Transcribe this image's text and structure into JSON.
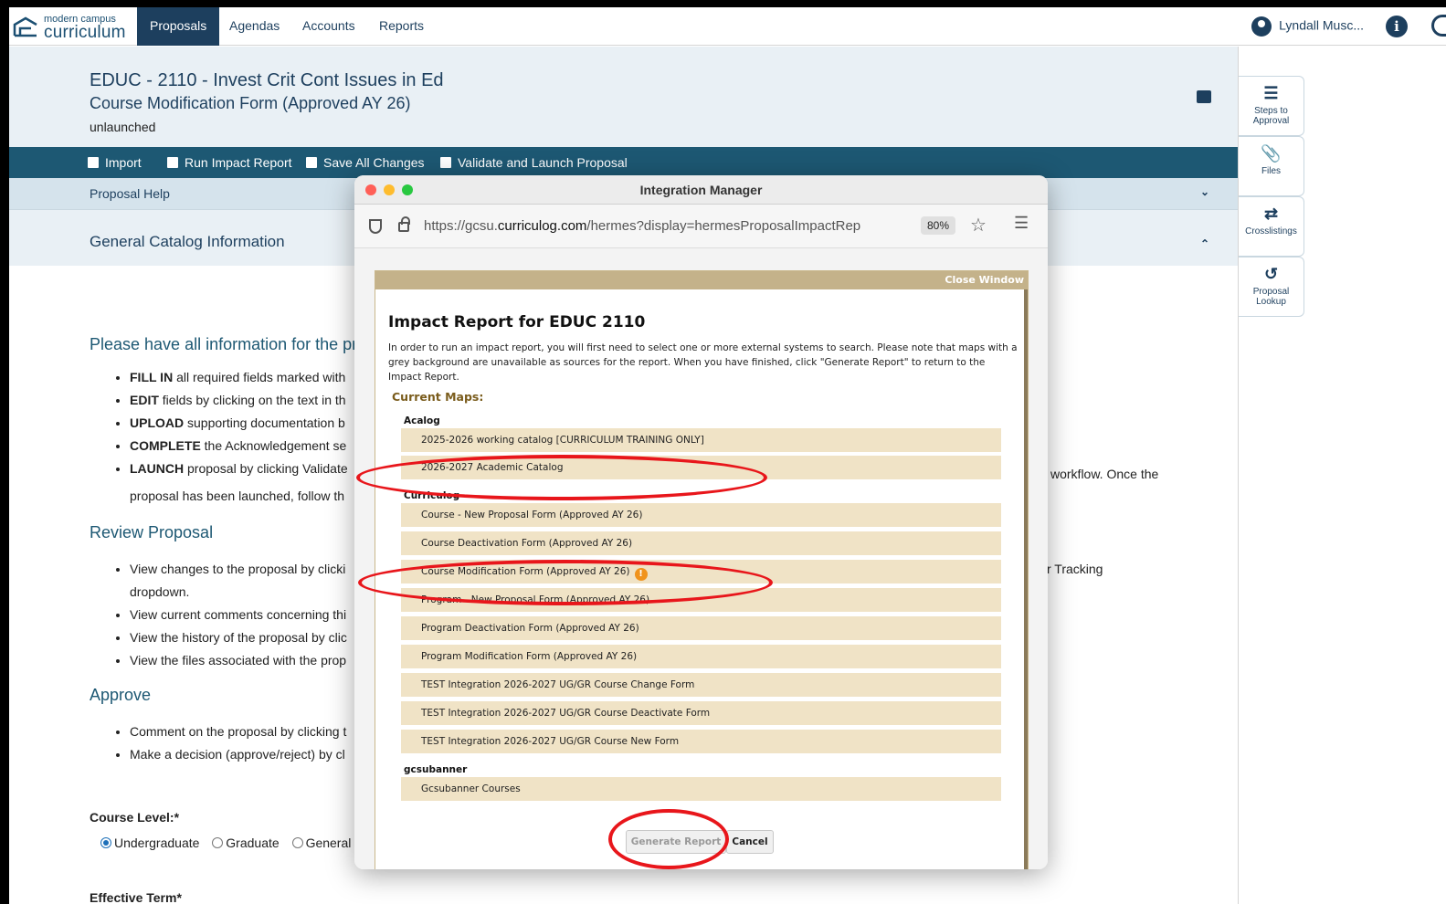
{
  "logo": {
    "small": "modern campus",
    "big": "curriculum"
  },
  "nav": {
    "items": [
      {
        "label": "Proposals"
      },
      {
        "label": "Agendas"
      },
      {
        "label": "Accounts"
      },
      {
        "label": "Reports"
      }
    ]
  },
  "user": {
    "name": "Lyndall Musc..."
  },
  "header": {
    "course_title": "EDUC - 2110 - Invest Crit Cont Issues in Ed",
    "form_name": "Course Modification Form (Approved AY 26)",
    "status": "unlaunched"
  },
  "toolbar": {
    "import": "Import",
    "impact": "Run Impact Report",
    "save": "Save All Changes",
    "validate": "Validate and Launch Proposal"
  },
  "sections": {
    "help": "Proposal Help",
    "general": "General Catalog Information"
  },
  "content": {
    "intro_heading": "Please have all information for the prop",
    "intro_items": [
      {
        "strong": "FILL IN",
        "text": " all required fields marked with"
      },
      {
        "strong": "EDIT",
        "text": " fields by clicking on the text in th"
      },
      {
        "strong": "UPLOAD",
        "text": " supporting documentation b"
      },
      {
        "strong": "COMPLETE",
        "text": " the Acknowledgement se"
      },
      {
        "strong": "LAUNCH",
        "text": " proposal by clicking Validate"
      }
    ],
    "launch_cont": "proposal has been launched, follow th",
    "workflow_text": "workflow. Once the",
    "review_heading": "Review Proposal",
    "review_items": [
      "View changes to the proposal by clicki",
      "View current comments concerning thi",
      "View the history of the proposal by clic",
      "View the files associated with the prop"
    ],
    "dropdown_text": "dropdown.",
    "tracking_text": "r Tracking",
    "approve_heading": "Approve",
    "approve_items": [
      "Comment on the proposal by clicking t",
      "Make a decision (approve/reject) by cl"
    ],
    "course_level_label": "Course Level:*",
    "course_level_options": [
      "Undergraduate",
      "Graduate",
      "General"
    ],
    "effective_term_label": "Effective Term*"
  },
  "sidebar": {
    "tabs": [
      {
        "label_line1": "Steps to",
        "label_line2": "Approval",
        "icon": "list-icon"
      },
      {
        "label_line1": "Files",
        "label_line2": "",
        "icon": "paperclip-icon"
      },
      {
        "label_line1": "Crosslistings",
        "label_line2": "",
        "icon": "shuffle-icon"
      },
      {
        "label_line1": "Proposal",
        "label_line2": "Lookup",
        "icon": "history-icon"
      }
    ]
  },
  "dialog": {
    "window_title": "Integration Manager",
    "url_prefix": "https://gcsu.",
    "url_domain": "curriculog.com",
    "url_rest": "/hermes?display=hermesProposalImpactRep",
    "zoom": "80%",
    "close_window": "Close Window",
    "report_title": "Impact Report for EDUC 2110",
    "report_desc": "In order to run an impact report, you will first need to select one or more external systems to search. Please note that maps with a grey background are unavailable as sources for the report. When you have finished, click \"Generate Report\" to return to the Impact Report.",
    "current_maps": "Current Maps:",
    "groups": {
      "acalog": "Acalog",
      "curriculog": "Curriculog",
      "gcsubanner": "gcsubanner"
    },
    "acalog_maps": [
      "2025-2026 working catalog [CURRICULUM TRAINING ONLY]",
      "2026-2027 Academic Catalog"
    ],
    "curriculog_maps": [
      "Course - New Proposal Form (Approved AY 26)",
      "Course Deactivation Form (Approved AY 26)",
      "Course Modification Form (Approved AY 26)",
      "Program - New Proposal Form (Approved AY 26)",
      "Program Deactivation Form (Approved AY 26)",
      "Program Modification Form (Approved AY 26)",
      "TEST Integration 2026-2027 UG/GR Course Change Form",
      "TEST Integration 2026-2027 UG/GR Course Deactivate Form",
      "TEST Integration 2026-2027 UG/GR Course New Form"
    ],
    "gcsubanner_maps": [
      "Gcsubanner Courses"
    ],
    "generate": "Generate Report",
    "cancel": "Cancel",
    "warn_glyph": "!"
  },
  "colors": {
    "navy": "#1d3f5e",
    "toolbar": "#1d5873",
    "map_bg": "#f0e3c6",
    "highlight": "#e8161b"
  }
}
